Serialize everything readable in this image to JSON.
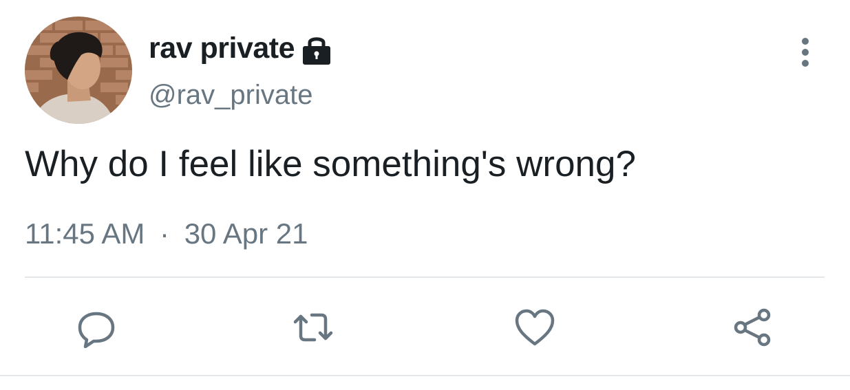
{
  "tweet": {
    "display_name": "rav private",
    "handle": "@rav_private",
    "text": "Why do I feel like something's wrong?",
    "time": "11:45 AM",
    "separator": "·",
    "date": "30 Apr 21"
  },
  "icons": {
    "lock": "lock-icon",
    "more": "vertical-ellipsis-icon",
    "reply": "speech-bubble-icon",
    "retweet": "retweet-icon",
    "like": "heart-icon",
    "share": "share-icon"
  },
  "colors": {
    "text": "#1a1f23",
    "secondary": "#677681",
    "divider": "#e3e7ea"
  }
}
